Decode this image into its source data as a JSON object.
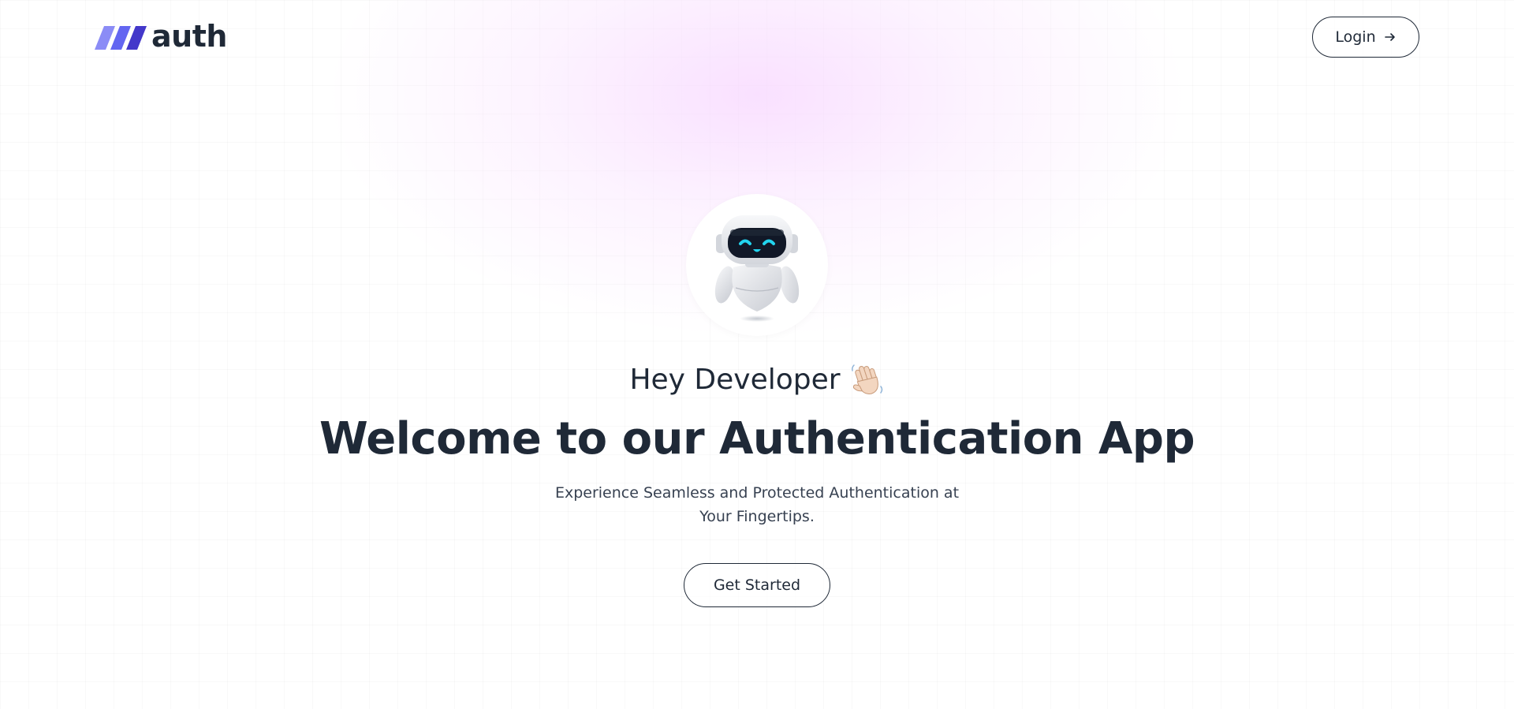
{
  "app": {
    "logo_text": "auth",
    "logo_colors": [
      "#8b8cf6",
      "#6366f1",
      "#4338ca"
    ]
  },
  "navbar": {
    "login_label": "Login",
    "login_icon": "arrow-right-icon"
  },
  "hero": {
    "avatar_icon": "robot-icon",
    "greeting": "Hey Developer",
    "greeting_icon": "waving-hand-icon",
    "title": "Welcome to our Authentication App",
    "subtitle": "Experience Seamless and Protected Authentication at Your Fingertips.",
    "cta_label": "Get Started"
  },
  "colors": {
    "text": "#1f2937",
    "glow": "#f7d6ff",
    "robot_eyes": "#22d3ee"
  }
}
